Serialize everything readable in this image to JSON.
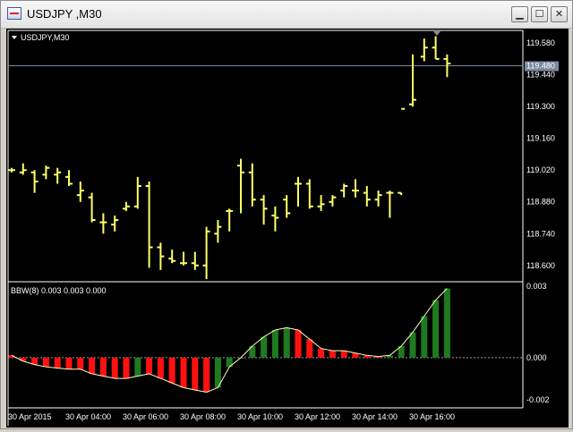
{
  "window": {
    "title": "USDJPY ,M30",
    "icons": {
      "app": "chart-window-icon",
      "minimize": "minimize-icon",
      "maximize": "maximize-icon",
      "close": "close-icon"
    },
    "min_glyph": "▁",
    "max_glyph": "☐",
    "close_glyph": "✕"
  },
  "colors": {
    "background": "#000000",
    "price_bars": "#ffff66",
    "current_price_line": "#7a8aa0",
    "up_histogram": "#1f7a1f",
    "down_histogram": "#ff1111",
    "bbw_line": "#ffffc0",
    "axis_text": "#ffffff"
  },
  "main_panel": {
    "label": "USDJPY,M30",
    "current_price": "119.480",
    "current_price_value": 119.48,
    "y_ticks": [
      "119.580",
      "119.440",
      "119.300",
      "119.160",
      "119.020",
      "118.880",
      "118.740",
      "118.600"
    ]
  },
  "indicator_panel": {
    "label": "BBW(8) 0.003 0.003 0.000",
    "y_ticks": [
      "0.003",
      "0.000",
      "-0.002"
    ]
  },
  "x_ticks": [
    "30 Apr 2015",
    "30 Apr 04:00",
    "30 Apr 06:00",
    "30 Apr 08:00",
    "30 Apr 10:00",
    "30 Apr 12:00",
    "30 Apr 14:00",
    "30 Apr 16:00"
  ],
  "chart_data": [
    {
      "type": "line",
      "subtype": "ohlc-bars",
      "title": "USDJPY,M30",
      "xlabel": "",
      "ylabel": "",
      "ylim": [
        118.54,
        119.62
      ],
      "grid": false,
      "bars": [
        {
          "o": 119.02,
          "h": 119.03,
          "l": 119.01,
          "c": 119.02
        },
        {
          "o": 119.01,
          "h": 119.05,
          "l": 119.0,
          "c": 119.02
        },
        {
          "o": 119.01,
          "h": 119.02,
          "l": 118.92,
          "c": 118.97
        },
        {
          "o": 119.0,
          "h": 119.04,
          "l": 118.98,
          "c": 119.03
        },
        {
          "o": 119.0,
          "h": 119.03,
          "l": 118.96,
          "c": 119.01
        },
        {
          "o": 118.99,
          "h": 119.02,
          "l": 118.95,
          "c": 118.96
        },
        {
          "o": 118.91,
          "h": 118.97,
          "l": 118.88,
          "c": 118.93
        },
        {
          "o": 118.9,
          "h": 118.92,
          "l": 118.79,
          "c": 118.8
        },
        {
          "o": 118.79,
          "h": 118.83,
          "l": 118.74,
          "c": 118.79
        },
        {
          "o": 118.78,
          "h": 118.82,
          "l": 118.75,
          "c": 118.8
        },
        {
          "o": 118.85,
          "h": 118.88,
          "l": 118.84,
          "c": 118.86
        },
        {
          "o": 118.86,
          "h": 118.99,
          "l": 118.85,
          "c": 118.95
        },
        {
          "o": 118.95,
          "h": 118.97,
          "l": 118.59,
          "c": 118.68
        },
        {
          "o": 118.68,
          "h": 118.7,
          "l": 118.58,
          "c": 118.64
        },
        {
          "o": 118.63,
          "h": 118.67,
          "l": 118.61,
          "c": 118.62
        },
        {
          "o": 118.61,
          "h": 118.66,
          "l": 118.6,
          "c": 118.61
        },
        {
          "o": 118.61,
          "h": 118.66,
          "l": 118.58,
          "c": 118.6
        },
        {
          "o": 118.6,
          "h": 118.77,
          "l": 118.54,
          "c": 118.75
        },
        {
          "o": 118.74,
          "h": 118.8,
          "l": 118.7,
          "c": 118.77
        },
        {
          "o": 118.84,
          "h": 118.85,
          "l": 118.75,
          "c": 118.84
        },
        {
          "o": 119.04,
          "h": 119.07,
          "l": 118.83,
          "c": 119.01
        },
        {
          "o": 119.01,
          "h": 119.05,
          "l": 118.86,
          "c": 118.89
        },
        {
          "o": 118.89,
          "h": 118.91,
          "l": 118.78,
          "c": 118.85
        },
        {
          "o": 118.82,
          "h": 118.86,
          "l": 118.75,
          "c": 118.81
        },
        {
          "o": 118.89,
          "h": 118.91,
          "l": 118.81,
          "c": 118.83
        },
        {
          "o": 118.96,
          "h": 118.99,
          "l": 118.86,
          "c": 118.96
        },
        {
          "o": 118.96,
          "h": 118.98,
          "l": 118.85,
          "c": 118.86
        },
        {
          "o": 118.86,
          "h": 118.91,
          "l": 118.84,
          "c": 118.87
        },
        {
          "o": 118.88,
          "h": 118.91,
          "l": 118.86,
          "c": 118.9
        },
        {
          "o": 118.93,
          "h": 118.96,
          "l": 118.9,
          "c": 118.95
        },
        {
          "o": 118.93,
          "h": 118.98,
          "l": 118.9,
          "c": 118.93
        },
        {
          "o": 118.92,
          "h": 118.95,
          "l": 118.86,
          "c": 118.89
        },
        {
          "o": 118.89,
          "h": 118.93,
          "l": 118.86,
          "c": 118.91
        },
        {
          "o": 118.92,
          "h": 118.93,
          "l": 118.81,
          "c": 118.92
        },
        {
          "o": 118.92,
          "h": 118.92,
          "l": 118.91,
          "c": 119.29
        },
        {
          "o": 119.31,
          "h": 119.53,
          "l": 119.3,
          "c": 119.33
        },
        {
          "o": 119.52,
          "h": 119.6,
          "l": 119.5,
          "c": 119.56
        },
        {
          "o": 119.56,
          "h": 119.61,
          "l": 119.51,
          "c": 119.51
        },
        {
          "o": 119.51,
          "h": 119.53,
          "l": 119.43,
          "c": 119.49
        }
      ]
    },
    {
      "type": "bar",
      "subtype": "histogram-with-line",
      "title": "BBW(8) 0.003 0.003 0.000",
      "xlabel": "",
      "ylabel": "",
      "ylim": [
        -0.0021,
        0.0031
      ],
      "grid": false,
      "values": [
        0.0001,
        -0.00015,
        -0.0003,
        -0.0004,
        -0.00045,
        -0.0005,
        -0.0005,
        -0.0007,
        -0.0008,
        -0.0009,
        -0.0009,
        -0.0008,
        -0.0007,
        -0.0009,
        -0.0011,
        -0.0013,
        -0.0014,
        -0.0015,
        -0.0013,
        -0.0004,
        0.0,
        0.0005,
        0.0009,
        0.0012,
        0.0013,
        0.0012,
        0.0008,
        0.0004,
        0.0003,
        0.0003,
        0.0002,
        0.0001,
        5e-05,
        0.0001,
        0.0005,
        0.0011,
        0.0018,
        0.0025,
        0.003
      ],
      "colors": [
        "down",
        "down",
        "down",
        "down",
        "down",
        "down",
        "down",
        "down",
        "down",
        "down",
        "down",
        "up",
        "down",
        "down",
        "down",
        "down",
        "down",
        "down",
        "up",
        "up",
        "up",
        "up",
        "up",
        "up",
        "up",
        "down",
        "down",
        "down",
        "down",
        "down",
        "down",
        "down",
        "down",
        "up",
        "up",
        "up",
        "up",
        "up",
        "up"
      ]
    }
  ]
}
